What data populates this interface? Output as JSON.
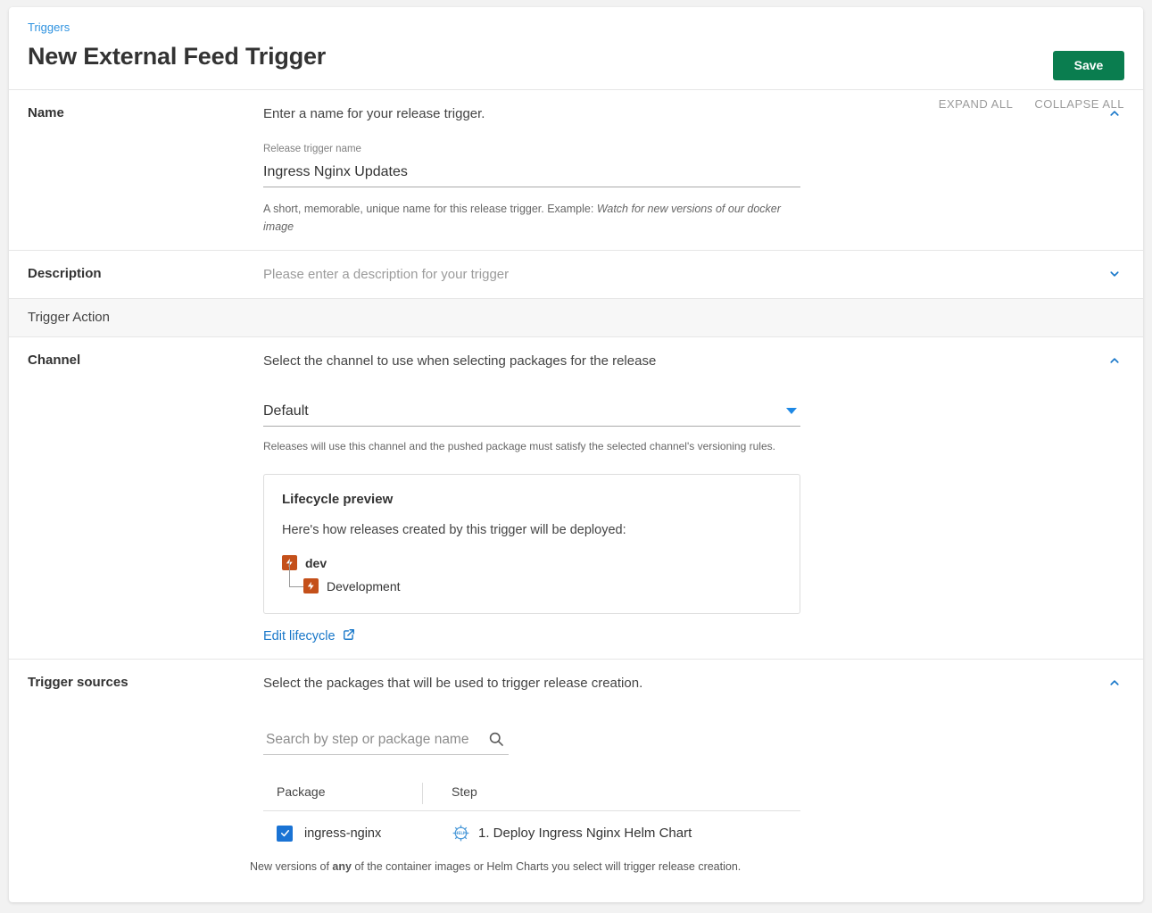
{
  "header": {
    "breadcrumb": "Triggers",
    "title": "New External Feed Trigger",
    "save_label": "Save",
    "expand_all_label": "EXPAND ALL",
    "collapse_all_label": "COLLAPSE ALL",
    "save_color": "#0a7d4f",
    "link_color": "#2f93e0"
  },
  "sections": {
    "name": {
      "label": "Name",
      "heading": "Enter a name for your release trigger.",
      "field_label": "Release trigger name",
      "field_value": "Ingress Nginx Updates",
      "help_prefix": "A short, memorable, unique name for this release trigger. Example: ",
      "help_italic": "Watch for new versions of our docker image",
      "chevron": "chevron-up-icon"
    },
    "description": {
      "label": "Description",
      "placeholder": "Please enter a description for your trigger",
      "chevron": "chevron-down-icon"
    },
    "trigger_action_band": "Trigger Action",
    "channel": {
      "label": "Channel",
      "heading": "Select the channel to use when selecting packages for the release",
      "selected": "Default",
      "options": [
        "Default"
      ],
      "help": "Releases will use this channel and the pushed package must satisfy the selected channel's versioning rules.",
      "chevron": "chevron-up-icon",
      "lifecycle": {
        "title": "Lifecycle preview",
        "subtitle": "Here's how releases created by this trigger will be deployed:",
        "nodes": [
          {
            "name": "dev",
            "bold": true,
            "icon": "lifecycle-bolt-icon",
            "color": "#c4501a"
          },
          {
            "name": "Development",
            "bold": false,
            "icon": "lifecycle-bolt-icon",
            "color": "#c4501a"
          }
        ],
        "edit_link": "Edit lifecycle",
        "edit_link_icon": "external-link-icon"
      }
    },
    "trigger_sources": {
      "label": "Trigger sources",
      "heading": "Select the packages that will be used to trigger release creation.",
      "chevron": "chevron-up-icon",
      "search_placeholder": "Search by step or package name",
      "search_value": "",
      "table": {
        "columns": [
          "Package",
          "Step"
        ],
        "rows": [
          {
            "checked": true,
            "package": "ingress-nginx",
            "step_icon": "helm-icon",
            "step": "1. Deploy Ingress Nginx Helm Chart"
          }
        ]
      },
      "note_prefix": "New versions of ",
      "note_bold": "any",
      "note_suffix": " of the container images or Helm Charts you select will trigger release creation."
    }
  }
}
